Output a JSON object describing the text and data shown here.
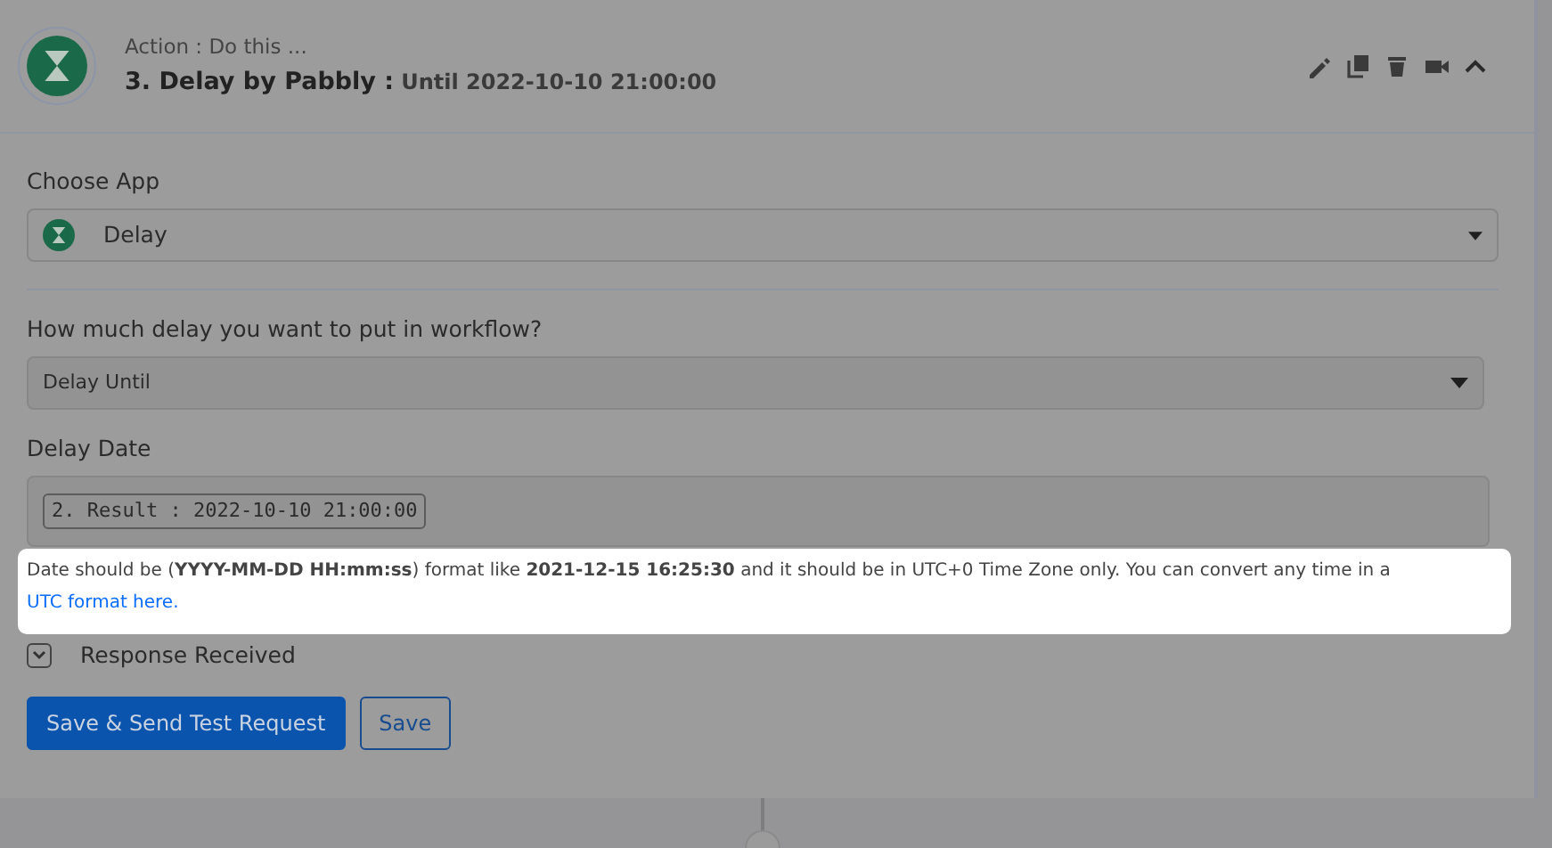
{
  "header": {
    "subtitle": "Action : Do this ...",
    "title": "3. Delay by Pabbly :",
    "detail": "Until 2022-10-10 21:00:00"
  },
  "choose_app": {
    "label": "Choose App",
    "value": "Delay"
  },
  "delay_type": {
    "label": "How much delay you want to put in workflow?",
    "value": "Delay Until"
  },
  "delay_date": {
    "label": "Delay Date",
    "token": "2. Result : 2022-10-10 21:00:00"
  },
  "hint": {
    "text": "Date should be (**YYYY-MM-DD HH:mm:ss**) format like **2021-12-15 16:25:30** and it should be in UTC+0 Time Zone only. You can convert any time in a",
    "link": "UTC format here."
  },
  "toggle": {
    "label": "Response Received"
  },
  "buttons": [
    {
      "label": "Save & Send Test Request",
      "kind": "primary"
    },
    {
      "label": "Save",
      "kind": "outline"
    }
  ]
}
